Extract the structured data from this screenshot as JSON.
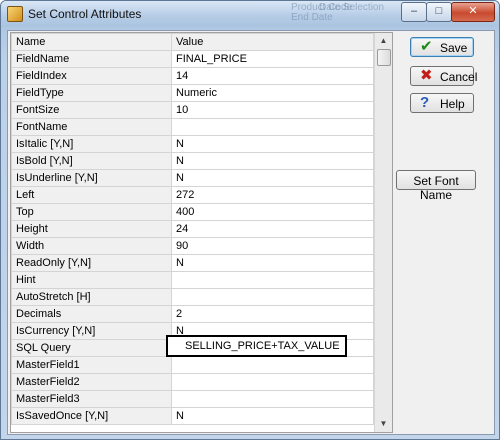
{
  "window": {
    "title": "Set Control Attributes",
    "ghost_texts": [
      "Product Code",
      "End Date",
      "Date Selection"
    ],
    "controls": {
      "minimize": "–",
      "maximize": "□",
      "close": "✕"
    }
  },
  "grid": {
    "columns": [
      "Name",
      "Value"
    ],
    "rows": [
      {
        "name": "FieldName",
        "value": "FINAL_PRICE"
      },
      {
        "name": "FieldIndex",
        "value": "14"
      },
      {
        "name": "FieldType",
        "value": "Numeric"
      },
      {
        "name": "FontSize",
        "value": "10"
      },
      {
        "name": "FontName",
        "value": ""
      },
      {
        "name": "IsItalic [Y,N]",
        "value": "N"
      },
      {
        "name": "IsBold [Y,N]",
        "value": "N"
      },
      {
        "name": "IsUnderline [Y,N]",
        "value": "N"
      },
      {
        "name": "Left",
        "value": "272"
      },
      {
        "name": "Top",
        "value": "400"
      },
      {
        "name": "Height",
        "value": "24"
      },
      {
        "name": "Width",
        "value": "90"
      },
      {
        "name": "ReadOnly [Y,N]",
        "value": "N"
      },
      {
        "name": "Hint",
        "value": ""
      },
      {
        "name": "AutoStretch [H]",
        "value": ""
      },
      {
        "name": "Decimals",
        "value": "2"
      },
      {
        "name": "IsCurrency [Y,N]",
        "value": "N"
      },
      {
        "name": "SQL Query",
        "value": ""
      },
      {
        "name": "MasterField1",
        "value": ""
      },
      {
        "name": "MasterField2",
        "value": ""
      },
      {
        "name": "MasterField3",
        "value": ""
      },
      {
        "name": "IsSavedOnce [Y,N]",
        "value": "N"
      }
    ],
    "editor_value": "SELLING_PRICE+TAX_VALUE",
    "scroll": {
      "up": "▲",
      "down": "▼"
    }
  },
  "buttons": {
    "save": "Save",
    "cancel": "Cancel",
    "help": "Help",
    "set_font": "Set Font Name"
  },
  "icons": {
    "save": "✔",
    "cancel": "✖",
    "help": "?",
    "save_color": "#1a8a1a",
    "cancel_color": "#c0201a",
    "help_color": "#2a5bb8"
  }
}
